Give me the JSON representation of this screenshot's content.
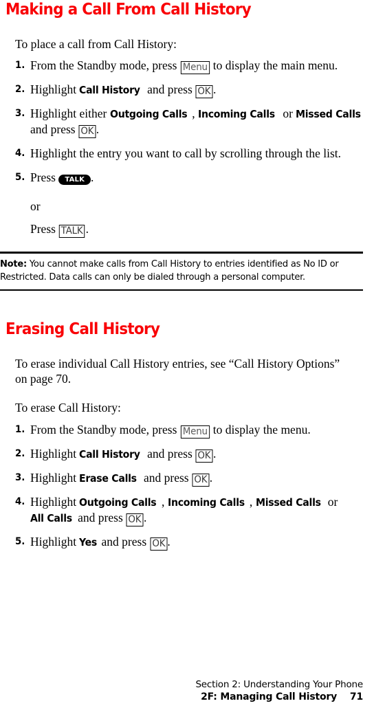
{
  "document": {
    "accent_color": "#f90005",
    "page_number": "71"
  },
  "sections": {
    "making": {
      "heading": "Making a Call From Call History",
      "intro": "To place a call from Call History:",
      "steps": [
        {
          "number": "1.",
          "before": "From the Standby mode, press",
          "key": "Menu",
          "after": "to display the main menu."
        },
        {
          "number": "2.",
          "before": "Highlight",
          "bold": "Call History",
          "mid": "and press",
          "key": "OK",
          "after": "."
        },
        {
          "number": "3.",
          "before": "Highlight either",
          "bold1": "Outgoing Calls",
          "sep1": ",",
          "bold2": "Incoming Calls",
          "sep2": "or",
          "bold3": "Missed Calls",
          "mid": "and press",
          "key": "OK",
          "after": "."
        },
        {
          "number": "4.",
          "text": "Highlight the entry you want to call by scrolling through the list."
        },
        {
          "number": "5.",
          "before": "Press",
          "pill_key": "TALK",
          "after": ".",
          "or_label": "or",
          "alt_before": "Press",
          "alt_key": "TALK",
          "alt_after": "."
        }
      ],
      "note": {
        "label": "Note:",
        "text": "You cannot make calls from Call History to entries identified as No ID or Restricted. Data calls can only be dialed through a personal computer."
      }
    },
    "erasing": {
      "heading": "Erasing Call History",
      "intro1": "To erase individual Call History entries, see “Call History Options” on page 70.",
      "intro2": "To erase Call History:",
      "steps": [
        {
          "number": "1.",
          "before": "From the Standby mode, press",
          "key": "Menu",
          "after": "to display the menu."
        },
        {
          "number": "2.",
          "before": "Highlight",
          "bold": "Call History",
          "mid": "and press",
          "key": "OK",
          "after": "."
        },
        {
          "number": "3.",
          "before": "Highlight",
          "bold": "Erase Calls",
          "mid": "and press",
          "key": "OK",
          "after": "."
        },
        {
          "number": "4.",
          "before": "Highlight",
          "bold1": "Outgoing Calls",
          "sep1": ",",
          "bold2": "Incoming Calls",
          "sep2": ",",
          "bold3": "Missed Calls",
          "sep3": "or",
          "bold4": "All Calls",
          "mid": "and press",
          "key": "OK",
          "after": "."
        },
        {
          "number": "5.",
          "before": "Highlight",
          "bold": "Yes",
          "mid": "and press",
          "key": "OK",
          "after": "."
        }
      ]
    }
  },
  "footer": {
    "line1": "Section 2: Understanding Your Phone",
    "line2": "2F: Managing Call History",
    "page": "71"
  }
}
